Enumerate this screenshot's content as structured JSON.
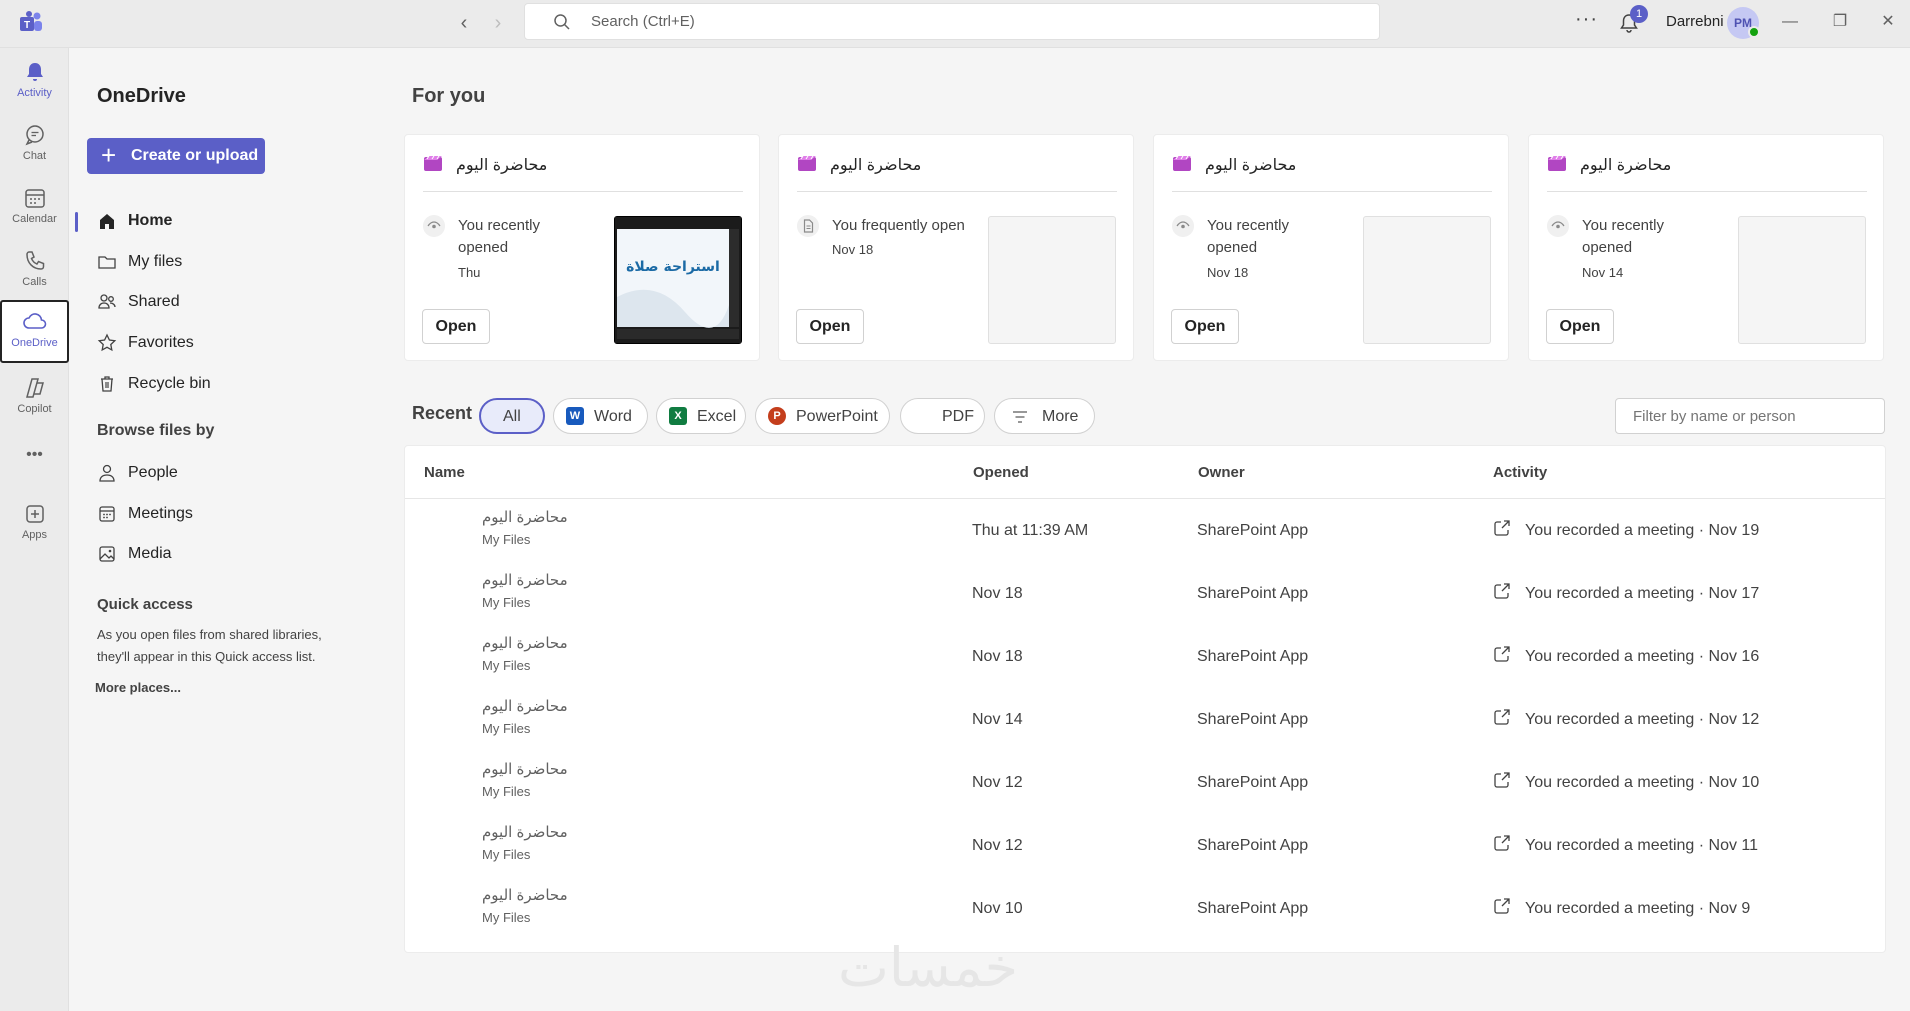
{
  "titlebar": {
    "search_placeholder": "Search (Ctrl+E)",
    "notification_count": "1",
    "username": "Darrebni",
    "avatar_initials": "PM",
    "more_glyph": "···",
    "back_glyph": "‹",
    "forward_glyph": "›",
    "minimize_glyph": "—",
    "restore_glyph": "❐",
    "close_glyph": "✕",
    "accent_color": "#5b5fc7"
  },
  "rail": {
    "items": [
      {
        "label": "Activity",
        "icon": "bell-icon"
      },
      {
        "label": "Chat",
        "icon": "chat-icon"
      },
      {
        "label": "Calendar",
        "icon": "calendar-icon"
      },
      {
        "label": "Calls",
        "icon": "phone-icon"
      },
      {
        "label": "OneDrive",
        "icon": "cloud-icon"
      },
      {
        "label": "Copilot",
        "icon": "copilot-icon"
      },
      {
        "label": "",
        "icon": "more-icon"
      },
      {
        "label": "Apps",
        "icon": "apps-icon"
      }
    ],
    "more_glyph": "•••"
  },
  "sidepanel": {
    "title": "OneDrive",
    "create_label": "Create or upload",
    "plus_glyph": "+",
    "nav": [
      {
        "label": "Home",
        "icon": "home-icon"
      },
      {
        "label": "My files",
        "icon": "folder-icon"
      },
      {
        "label": "Shared",
        "icon": "people-icon"
      },
      {
        "label": "Favorites",
        "icon": "star-icon"
      },
      {
        "label": "Recycle bin",
        "icon": "trash-icon"
      }
    ],
    "browse_heading": "Browse files by",
    "browse": [
      {
        "label": "People",
        "icon": "person-icon"
      },
      {
        "label": "Meetings",
        "icon": "calendar-icon"
      },
      {
        "label": "Media",
        "icon": "image-icon"
      }
    ],
    "quick_access_heading": "Quick access",
    "quick_access_desc": "As you open files from shared libraries, they'll appear in this Quick access list.",
    "more_places": "More places..."
  },
  "main": {
    "for_you_heading": "For you",
    "cards": [
      {
        "title": "محاضرة اليوم",
        "reason": "You recently opened",
        "date": "Thu",
        "open_label": "Open",
        "thumb_text": "استراحة صلاة"
      },
      {
        "title": "محاضرة اليوم",
        "reason": "You frequently open",
        "date": "Nov 18",
        "open_label": "Open"
      },
      {
        "title": "محاضرة اليوم",
        "reason": "You recently opened",
        "date": "Nov 18",
        "open_label": "Open"
      },
      {
        "title": "محاضرة اليوم",
        "reason": "You recently opened",
        "date": "Nov 14",
        "open_label": "Open"
      }
    ],
    "recent_label": "Recent",
    "filters": [
      "All",
      "Word",
      "Excel",
      "PowerPoint",
      "PDF",
      "More"
    ],
    "filter_placeholder": "Filter by name or person",
    "columns": [
      "Name",
      "Opened",
      "Owner",
      "Activity"
    ],
    "rows": [
      {
        "name": "محاضرة اليوم",
        "location": "My Files",
        "opened": "Thu at 11:39 AM",
        "owner": "SharePoint App",
        "activity": "You recorded a meeting · Nov 19"
      },
      {
        "name": "محاضرة اليوم",
        "location": "My Files",
        "opened": "Nov 18",
        "owner": "SharePoint App",
        "activity": "You recorded a meeting · Nov 17"
      },
      {
        "name": "محاضرة اليوم",
        "location": "My Files",
        "opened": "Nov 18",
        "owner": "SharePoint App",
        "activity": "You recorded a meeting · Nov 16"
      },
      {
        "name": "محاضرة اليوم",
        "location": "My Files",
        "opened": "Nov 14",
        "owner": "SharePoint App",
        "activity": "You recorded a meeting · Nov 12"
      },
      {
        "name": "محاضرة اليوم",
        "location": "My Files",
        "opened": "Nov 12",
        "owner": "SharePoint App",
        "activity": "You recorded a meeting · Nov 10"
      },
      {
        "name": "محاضرة اليوم",
        "location": "My Files",
        "opened": "Nov 12",
        "owner": "SharePoint App",
        "activity": "You recorded a meeting · Nov 11"
      },
      {
        "name": "محاضرة اليوم",
        "location": "My Files",
        "opened": "Nov 10",
        "owner": "SharePoint App",
        "activity": "You recorded a meeting · Nov 9"
      }
    ]
  },
  "watermark": "خمسات"
}
